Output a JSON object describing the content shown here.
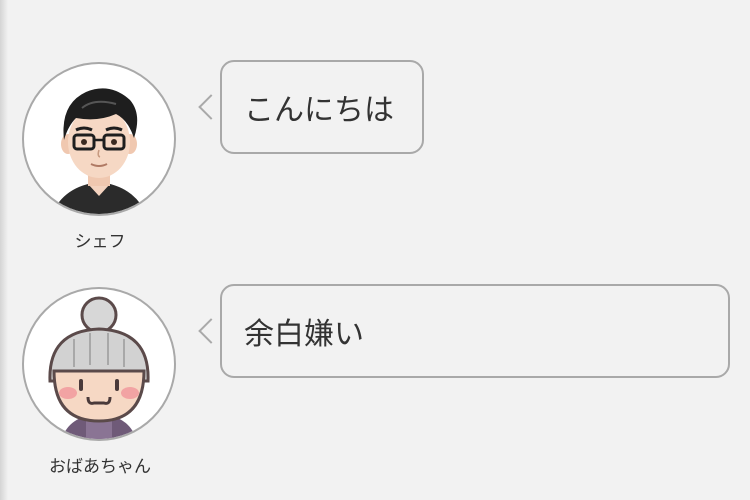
{
  "messages": [
    {
      "speaker": "シェフ",
      "avatar_icon": "chef-avatar-icon",
      "text": "こんにちは"
    },
    {
      "speaker": "おばあちゃん",
      "avatar_icon": "grandma-avatar-icon",
      "text": "余白嫌い"
    }
  ],
  "colors": {
    "background": "#f2f2f2",
    "border": "#a9a9a9",
    "text": "#333333"
  }
}
